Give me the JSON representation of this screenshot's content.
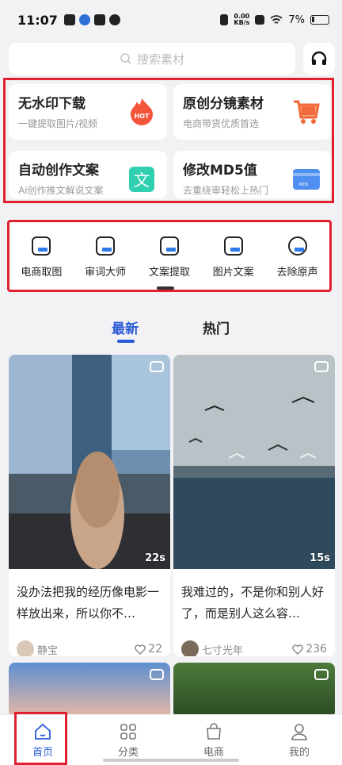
{
  "status_bar": {
    "time": "11:07",
    "network_speed": "0.00",
    "network_unit": "KB/s",
    "battery": "7%"
  },
  "search": {
    "placeholder": "搜索素材"
  },
  "features": [
    {
      "title": "无水印下载",
      "subtitle": "一键提取图片/视频",
      "badge": "HOT"
    },
    {
      "title": "原创分镜素材",
      "subtitle": "电商带货优质首选"
    },
    {
      "title": "自动创作文案",
      "subtitle": "Ai创作推文解说文案",
      "badge": "文"
    },
    {
      "title": "修改MD5值",
      "subtitle": "去重绕审轻松上热门",
      "badge": "MD5"
    }
  ],
  "tools": [
    {
      "label": "电商取图",
      "icon": "image-frame-icon"
    },
    {
      "label": "审词大师",
      "icon": "audit-icon"
    },
    {
      "label": "文案提取",
      "icon": "text-extract-icon"
    },
    {
      "label": "图片文案",
      "icon": "picture-icon"
    },
    {
      "label": "去除原声",
      "icon": "mute-icon"
    }
  ],
  "tabs": {
    "latest": "最新",
    "hot": "热门"
  },
  "posts": [
    {
      "duration": "22s",
      "text": "没办法把我的经历像电影一样放出来，所以你不…",
      "author": "静宝",
      "likes": "22"
    },
    {
      "duration": "15s",
      "text": "我难过的，不是你和别人好了，而是别人这么容…",
      "author": "七寸光年",
      "likes": "236"
    }
  ],
  "bottom_nav": {
    "home": "首页",
    "category": "分类",
    "shop": "电商",
    "mine": "我的"
  },
  "colors": {
    "accent": "#2a5bd7",
    "highlight_box": "#e0202f"
  }
}
